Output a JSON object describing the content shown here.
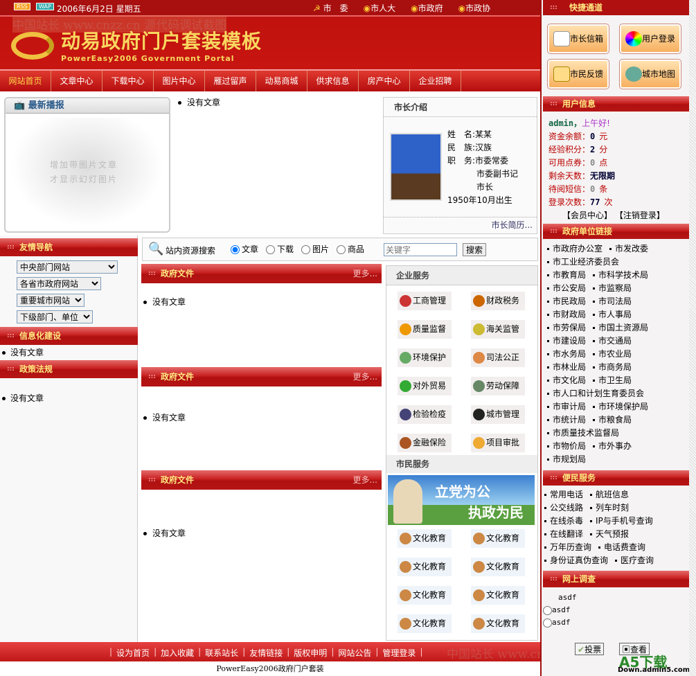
{
  "topbar": {
    "rss": "RSS",
    "wap": "WAP",
    "date": "2006年6月2日 星期五",
    "links": [
      "市　委",
      "市人大",
      "市政府",
      "市政协"
    ]
  },
  "header": {
    "title": "动易政府门户套装模板",
    "subtitle": "PowerEasy2006 Government Portal",
    "watermark": "中国站长 www.cnzz.cn 源代码调试截图"
  },
  "nav": [
    "网站首页",
    "文章中心",
    "下载中心",
    "图片中心",
    "雁过留声",
    "动易商城",
    "供求信息",
    "房产中心",
    "企业招聘"
  ],
  "news": {
    "title": "最新播报",
    "placeholder_line1": "增加带图片文章",
    "placeholder_line2": "才显示幻灯图片",
    "empty": "没有文章"
  },
  "mayor": {
    "title": "市长介绍",
    "name_label": "姓　名:",
    "name": "某某",
    "ethnic_label": "民　族:",
    "ethnic": "汉族",
    "post_label": "职　务:",
    "posts": [
      "市委常委",
      "市委副书记",
      "市长"
    ],
    "birth": "1950年10月出生",
    "more": "市长简历..."
  },
  "left": {
    "friend_title": "友情导航",
    "selects": [
      "中央部门网站",
      "各省市政府网站",
      "重要城市网站",
      "下级部门、单位"
    ],
    "info_title": "信息化建设",
    "info_empty": "没有文章",
    "policy_title": "政策法规",
    "policy_empty": "没有文章"
  },
  "search": {
    "label": "站内资源搜索",
    "options": [
      "文章",
      "下载",
      "图片",
      "商品"
    ],
    "selected": "文章",
    "placeholder": "关键字",
    "button": "搜索"
  },
  "docs": [
    {
      "title": "政府文件",
      "more": "更多...",
      "empty": "没有文章"
    },
    {
      "title": "政府文件",
      "more": "更多...",
      "empty": "没有文章"
    },
    {
      "title": "政府文件",
      "more": "更多...",
      "empty": "没有文章"
    }
  ],
  "enterprise": {
    "title": "企业服务",
    "items": [
      "工商管理",
      "财政税务",
      "质量监督",
      "海关监管",
      "环境保护",
      "司法公正",
      "对外贸易",
      "劳动保障",
      "检验检疫",
      "城市管理",
      "金融保险",
      "项目审批"
    ]
  },
  "citizen": {
    "title": "市民服务",
    "banner1": "立党为公",
    "banner2": "执政为民",
    "items": [
      "文化教育",
      "文化教育",
      "文化教育",
      "文化教育",
      "文化教育",
      "文化教育",
      "文化教育",
      "文化教育"
    ]
  },
  "quick": {
    "title": "快捷通道",
    "buttons": [
      "市长信箱",
      "用户登录",
      "市民反馈",
      "城市地图"
    ]
  },
  "user": {
    "title": "用户信息",
    "name": "admin，",
    "greet": "上午好!",
    "rows": [
      [
        "资金余额：",
        "0",
        "元"
      ],
      [
        "经验积分：",
        "2",
        "分"
      ],
      [
        "可用点券：",
        "0",
        "点"
      ],
      [
        "剩余天数：",
        "无限期",
        ""
      ],
      [
        "待阅短信：",
        "0",
        "条"
      ],
      [
        "登录次数：",
        "77",
        "次"
      ]
    ],
    "member": "【会员中心】",
    "logout": "【注销登录】"
  },
  "units": {
    "title": "政府单位链接",
    "rows": [
      [
        "市政府办公室",
        "市发改委"
      ],
      [
        "市工业经济委员会"
      ],
      [
        "市教育局",
        "市科学技术局"
      ],
      [
        "市公安局",
        "市监察局"
      ],
      [
        "市民政局",
        "市司法局"
      ],
      [
        "市财政局",
        "市人事局"
      ],
      [
        "市劳保局",
        "市国土资源局"
      ],
      [
        "市建设局",
        "市交通局"
      ],
      [
        "市水务局",
        "市农业局"
      ],
      [
        "市林业局",
        "市商务局"
      ],
      [
        "市文化局",
        "市卫生局"
      ],
      [
        "市人口和计划生育委员会"
      ],
      [
        "市审计局",
        "市环境保护局"
      ],
      [
        "市统计局",
        "市粮食局"
      ],
      [
        "市质量技术监督局"
      ],
      [
        "市物价局",
        "市外事办"
      ],
      [
        "市规划局"
      ]
    ]
  },
  "services": {
    "title": "便民服务",
    "rows": [
      [
        "常用电话",
        "航班信息"
      ],
      [
        "公交线路",
        "列车时刻"
      ],
      [
        "在线杀毒",
        "IP与手机号查询"
      ],
      [
        "在线翻译",
        "天气预报"
      ],
      [
        "万年历查询",
        "电话费查询"
      ],
      [
        "身份证真伪查询",
        "医疗查询"
      ]
    ]
  },
  "survey": {
    "title": "网上调查",
    "question": "asdf",
    "options": [
      "asdf",
      "asdf"
    ],
    "vote": "投票",
    "view": "查看"
  },
  "footer": {
    "links": [
      "设为首页",
      "加入收藏",
      "联系站长",
      "友情链接",
      "版权申明",
      "网站公告",
      "管理登录"
    ],
    "copyright": "PowerEasy2006政府门户套装",
    "a5": "A5下载",
    "a5url": "Down.admin5.com"
  }
}
